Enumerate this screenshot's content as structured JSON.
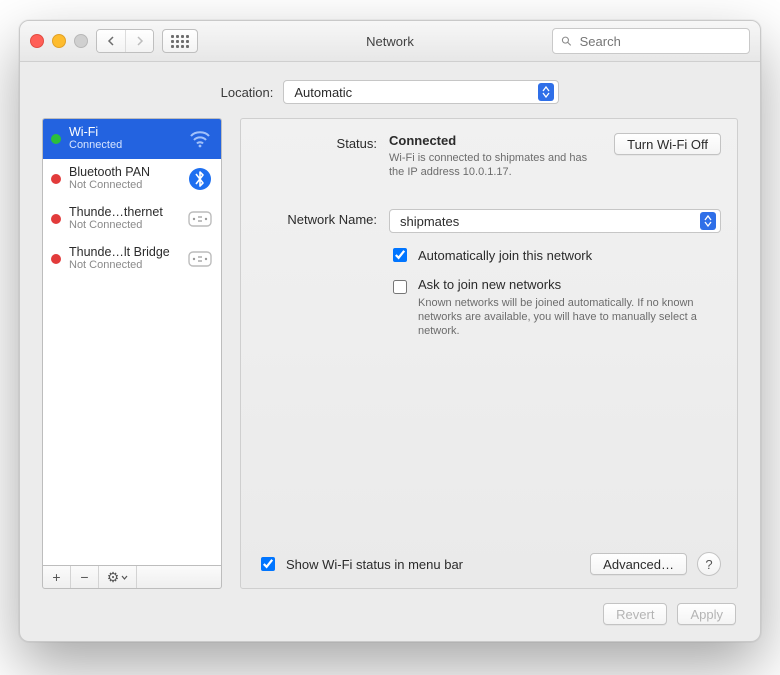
{
  "window": {
    "title": "Network"
  },
  "toolbar": {
    "search_placeholder": "Search"
  },
  "location": {
    "label": "Location:",
    "value": "Automatic"
  },
  "sidebar": {
    "items": [
      {
        "name": "Wi-Fi",
        "status": "Connected",
        "dot": "green",
        "icon": "wifi",
        "selected": true
      },
      {
        "name": "Bluetooth PAN",
        "status": "Not Connected",
        "dot": "red",
        "icon": "bluetooth"
      },
      {
        "name": "Thunde…thernet",
        "status": "Not Connected",
        "dot": "red",
        "icon": "thunderbolt"
      },
      {
        "name": "Thunde…lt Bridge",
        "status": "Not Connected",
        "dot": "red",
        "icon": "thunderbolt"
      }
    ],
    "toolbar": {
      "add": "+",
      "remove": "−",
      "action": "⚙︎"
    }
  },
  "detail": {
    "status_label": "Status:",
    "status_value": "Connected",
    "wifi_toggle": "Turn Wi-Fi Off",
    "status_desc": "Wi-Fi is connected to shipmates and has the IP address 10.0.1.17.",
    "network_label": "Network Name:",
    "network_value": "shipmates",
    "auto_join": "Automatically join this network",
    "ask_join": "Ask to join new networks",
    "ask_join_desc": "Known networks will be joined automatically. If no known networks are available, you will have to manually select a network.",
    "show_menu": "Show Wi-Fi status in menu bar",
    "advanced": "Advanced…",
    "help": "?"
  },
  "footer": {
    "revert": "Revert",
    "apply": "Apply"
  },
  "colors": {
    "accent": "#2f6fe8"
  }
}
